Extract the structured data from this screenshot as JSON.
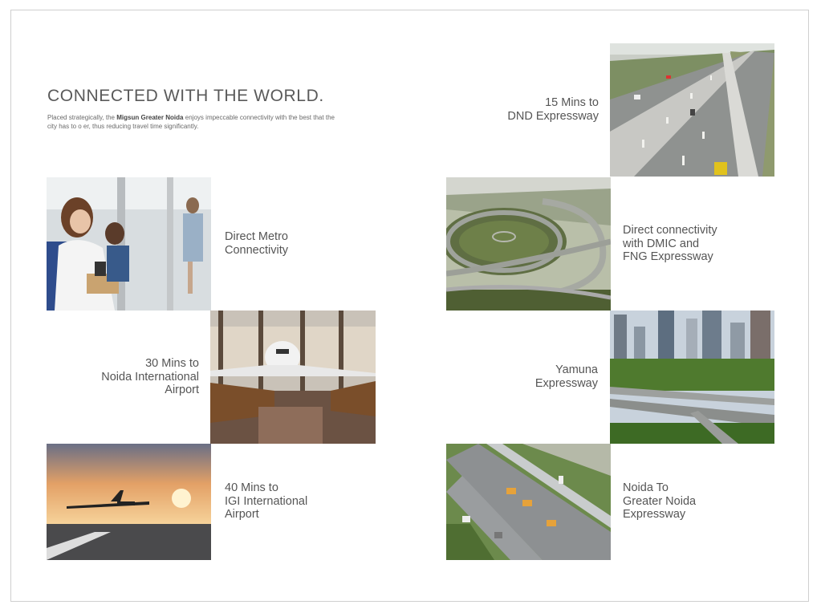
{
  "heading": {
    "title": "CONNECTED WITH THE WORLD.",
    "intro_before": "Placed strategically, the ",
    "intro_brand": "Migsun Greater Noida",
    "intro_after": " enjoys impeccable connectivity with the best that the city has to o er, thus reducing travel time significantly."
  },
  "features": {
    "dnd": "15 Mins to\nDND Expressway",
    "metro": "Direct Metro\nConnectivity",
    "dmic": "Direct connectivity\nwith DMIC and\nFNG Expressway",
    "noida_airport": "30 Mins to\nNoida International\nAirport",
    "yamuna": "Yamuna\nExpressway",
    "igi": "40 Mins to\nIGI International\nAirport",
    "noida_gn": "Noida To\nGreater Noida\nExpressway"
  },
  "images": {
    "dnd": "highway-photo",
    "metro": "metro-passenger-photo",
    "dmic": "interchange-photo",
    "noida_airport": "airport-lounge-photo",
    "yamuna": "city-expressway-photo",
    "igi": "plane-sunset-photo",
    "noida_gn": "aerial-expressway-photo"
  }
}
